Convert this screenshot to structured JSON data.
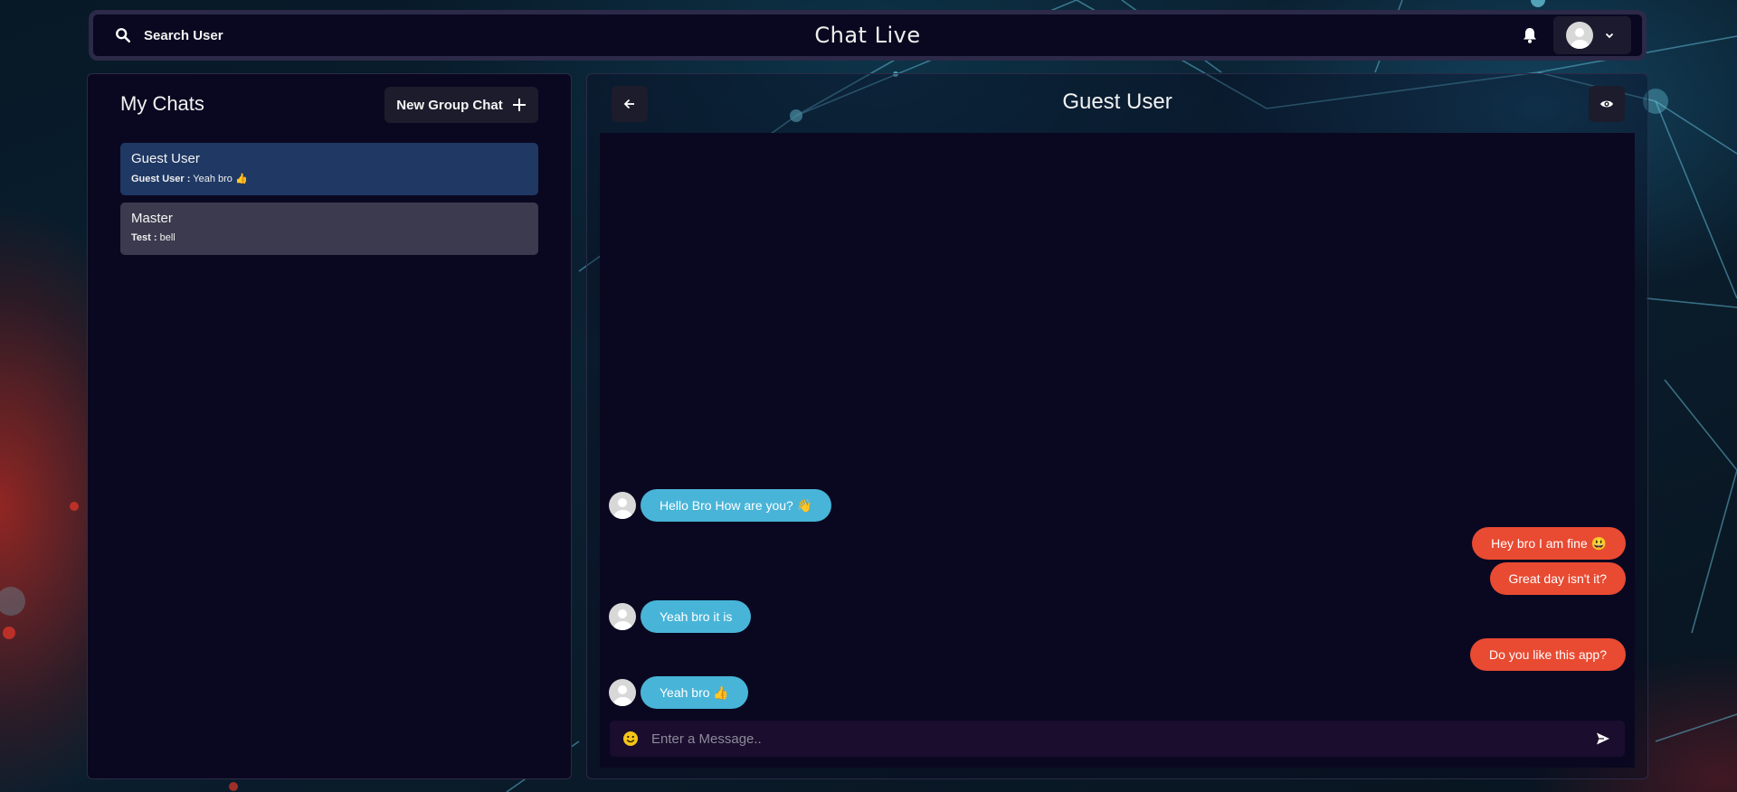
{
  "header": {
    "search_label": "Search User",
    "app_title": "Chat Live"
  },
  "sidebar": {
    "title": "My Chats",
    "new_group_label": "New Group Chat",
    "chats": [
      {
        "name": "Guest User",
        "sender": "Guest User :",
        "preview": "Yeah bro 👍",
        "active": true
      },
      {
        "name": "Master",
        "sender": "Test :",
        "preview": "bell",
        "active": false
      }
    ]
  },
  "conversation": {
    "title": "Guest User",
    "messages": [
      {
        "text": "Hello Bro How are you? 👋",
        "direction": "incoming"
      },
      {
        "text": "Hey bro I am fine 😃",
        "direction": "outgoing"
      },
      {
        "text": "Great day isn't it?",
        "direction": "outgoing"
      },
      {
        "text": "Yeah bro it is",
        "direction": "incoming"
      },
      {
        "text": "Do you like this app?",
        "direction": "outgoing"
      },
      {
        "text": "Yeah bro 👍",
        "direction": "incoming"
      }
    ],
    "input_placeholder": "Enter a Message.."
  },
  "icons": {
    "search": "search-icon",
    "bell": "bell-icon",
    "profile": "avatar",
    "chevron": "chevron-down-icon",
    "plus": "plus-icon",
    "back": "arrow-left-icon",
    "view": "eye-icon",
    "emoji": "smiley-icon",
    "send": "send-icon"
  },
  "colors": {
    "incoming_bubble": "#48b4d8",
    "outgoing_bubble": "#e84a32",
    "active_chat": "#1f3864",
    "inactive_chat": "#3c3a4e",
    "panel_bg": "#0a0820"
  }
}
